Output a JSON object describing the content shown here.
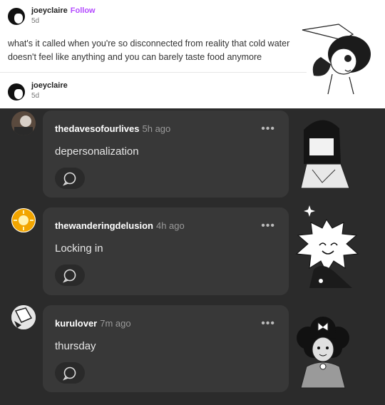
{
  "post": {
    "username": "joeyclaire",
    "follow_label": "Follow",
    "time": "5d",
    "text": "what's it called when you're so disconnected from reality that cold water doesn't feel like anything and you can barely taste food anymore"
  },
  "reblog": {
    "username": "joeyclaire",
    "time": "5d"
  },
  "comments": [
    {
      "username": "thedavesofourlives",
      "time": "5h ago",
      "text": "depersonalization"
    },
    {
      "username": "thewanderingdelusion",
      "time": "4h ago",
      "text": "Locking in"
    },
    {
      "username": "kurulover",
      "time": "7m ago",
      "text": "thursday"
    }
  ],
  "icons": {
    "more": "more-dots-icon",
    "reply": "speech-bubble-icon"
  },
  "colors": {
    "follow": "#b44bff",
    "comment_bg": "#383838",
    "page_bg": "#2b2b2b"
  }
}
